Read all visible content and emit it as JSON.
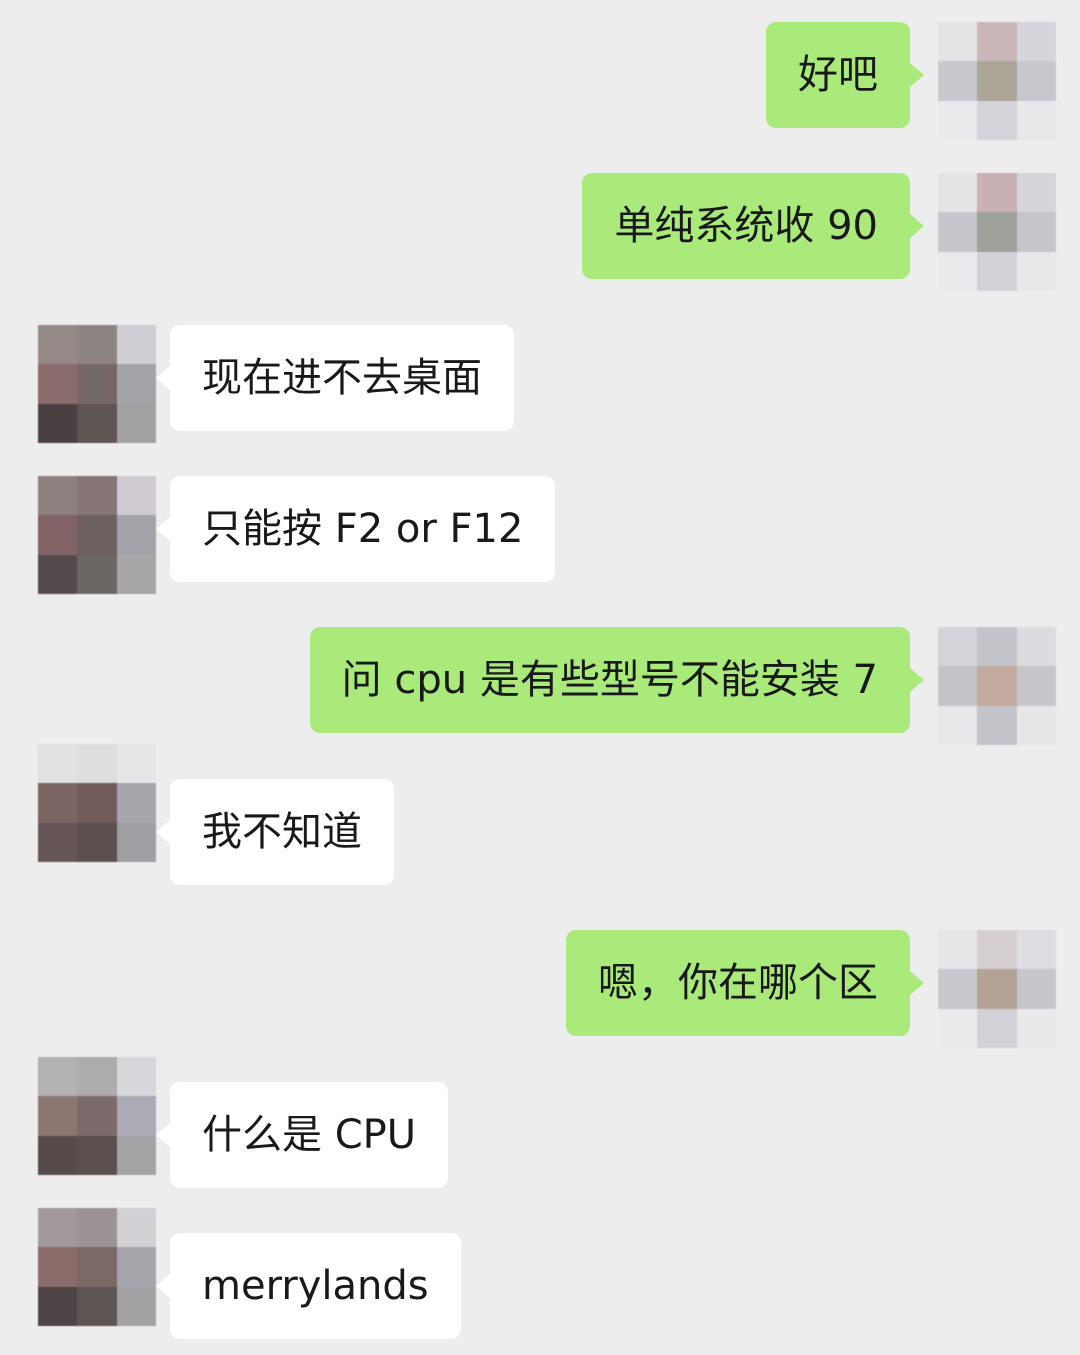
{
  "colors": {
    "background": "#ededed",
    "outgoing_bubble": "#a9ea7a",
    "incoming_bubble": "#ffffff",
    "text": "#191919"
  },
  "messages": [
    {
      "side": "right",
      "text": "好吧"
    },
    {
      "side": "right",
      "text": "单纯系统收 90"
    },
    {
      "side": "left",
      "text": "现在进不去桌面"
    },
    {
      "side": "left",
      "text": "只能按 F2 or F12"
    },
    {
      "side": "right",
      "text": "问 cpu 是有些型号不能安装 7"
    },
    {
      "side": "left",
      "text": "我不知道"
    },
    {
      "side": "right",
      "text": "嗯，你在哪个区"
    },
    {
      "side": "left",
      "text": "什么是 CPU"
    },
    {
      "side": "left",
      "text": "merrylands"
    }
  ]
}
